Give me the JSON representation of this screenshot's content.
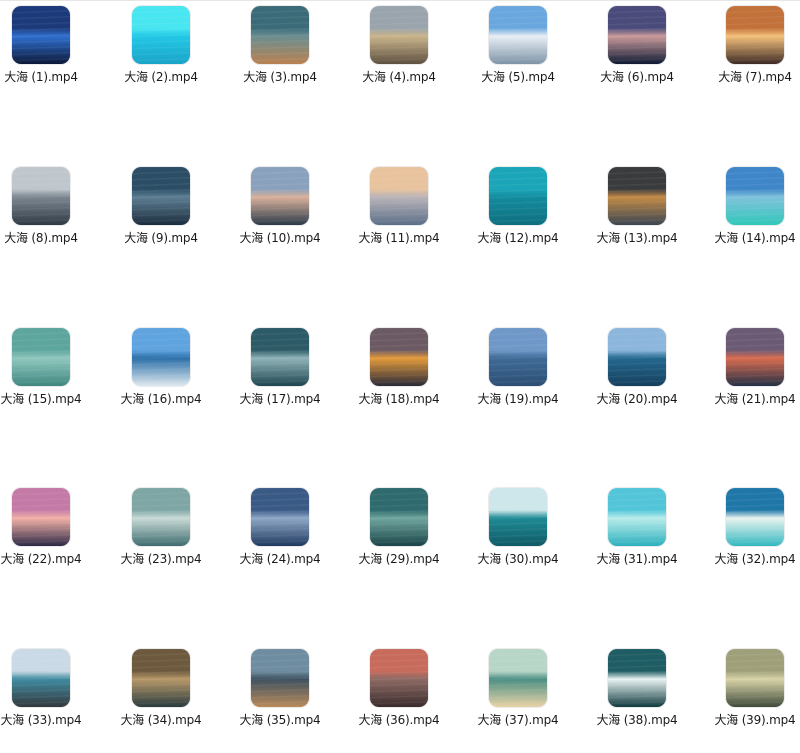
{
  "files": [
    {
      "name": "大海 (1).mp4",
      "colors": [
        "#1c3a7a",
        "#2f6fd0",
        "#0c1838"
      ],
      "icon": "video-thumbnail-icon"
    },
    {
      "name": "大海 (2).mp4",
      "colors": [
        "#48e6f0",
        "#22c8e6",
        "#1aa3c8"
      ],
      "icon": "video-thumbnail-icon"
    },
    {
      "name": "大海 (3).mp4",
      "colors": [
        "#3b6b78",
        "#6a8e92",
        "#b98150"
      ],
      "icon": "video-thumbnail-icon"
    },
    {
      "name": "大海 (4).mp4",
      "colors": [
        "#9aa4ad",
        "#c9b48a",
        "#5e5040"
      ],
      "icon": "video-thumbnail-icon"
    },
    {
      "name": "大海 (5).mp4",
      "colors": [
        "#6aa7de",
        "#e8eef5",
        "#7d93a6"
      ],
      "icon": "video-thumbnail-icon"
    },
    {
      "name": "大海 (6).mp4",
      "colors": [
        "#4a4b7a",
        "#c99a9a",
        "#0e1a33"
      ],
      "icon": "video-thumbnail-icon"
    },
    {
      "name": "大海 (7).mp4",
      "colors": [
        "#c2713a",
        "#f4c07a",
        "#3d2a25"
      ],
      "icon": "video-thumbnail-icon"
    },
    {
      "name": "大海 (8).mp4",
      "colors": [
        "#bfc6cc",
        "#7b8690",
        "#2f3a44"
      ],
      "icon": "video-thumbnail-icon"
    },
    {
      "name": "大海 (9).mp4",
      "colors": [
        "#2b4e66",
        "#5c7d92",
        "#1b2d3d"
      ],
      "icon": "video-thumbnail-icon"
    },
    {
      "name": "大海 (10).mp4",
      "colors": [
        "#8aa1bd",
        "#d8b09a",
        "#2b3a4a"
      ],
      "icon": "video-thumbnail-icon"
    },
    {
      "name": "大海 (11).mp4",
      "colors": [
        "#e8c39e",
        "#b9b3b8",
        "#5b6f88"
      ],
      "icon": "video-thumbnail-icon"
    },
    {
      "name": "大海 (12).mp4",
      "colors": [
        "#1aa6b8",
        "#138c9e",
        "#0f6f80"
      ],
      "icon": "video-thumbnail-icon"
    },
    {
      "name": "大海 (13).mp4",
      "colors": [
        "#3a3b3d",
        "#c28a45",
        "#3b4652"
      ],
      "icon": "video-thumbnail-icon"
    },
    {
      "name": "大海 (14).mp4",
      "colors": [
        "#3f86c9",
        "#7fc2dc",
        "#30c7b8"
      ],
      "icon": "video-thumbnail-icon"
    },
    {
      "name": "大海 (15).mp4",
      "colors": [
        "#5da69e",
        "#8fc7bd",
        "#3f8780"
      ],
      "icon": "video-thumbnail-icon"
    },
    {
      "name": "大海 (16).mp4",
      "colors": [
        "#5fa3df",
        "#2c6fa8",
        "#dfe9ef"
      ],
      "icon": "video-thumbnail-icon"
    },
    {
      "name": "大海 (17).mp4",
      "colors": [
        "#2c5a66",
        "#8fb3b8",
        "#1e4650"
      ],
      "icon": "video-thumbnail-icon"
    },
    {
      "name": "大海 (18).mp4",
      "colors": [
        "#6b5a63",
        "#e39a3a",
        "#2a2a38"
      ],
      "icon": "video-thumbnail-icon"
    },
    {
      "name": "大海 (19).mp4",
      "colors": [
        "#6f98c8",
        "#3e6a96",
        "#2d4f75"
      ],
      "icon": "video-thumbnail-icon"
    },
    {
      "name": "大海 (20).mp4",
      "colors": [
        "#8db6dc",
        "#23688f",
        "#16405e"
      ],
      "icon": "video-thumbnail-icon"
    },
    {
      "name": "大海 (21).mp4",
      "colors": [
        "#6b5a74",
        "#d96b4f",
        "#243045"
      ],
      "icon": "video-thumbnail-icon"
    },
    {
      "name": "大海 (22).mp4",
      "colors": [
        "#c47aa6",
        "#f2b0a6",
        "#2e2a46"
      ],
      "icon": "video-thumbnail-icon"
    },
    {
      "name": "大海 (23).mp4",
      "colors": [
        "#7ea6a4",
        "#c9dad6",
        "#3e6c6e"
      ],
      "icon": "video-thumbnail-icon"
    },
    {
      "name": "大海 (24).mp4",
      "colors": [
        "#3a5a86",
        "#8ea7c6",
        "#1f3a60"
      ],
      "icon": "video-thumbnail-icon"
    },
    {
      "name": "大海 (29).mp4",
      "colors": [
        "#2e6a6e",
        "#6fa59e",
        "#1a4448"
      ],
      "icon": "video-thumbnail-icon"
    },
    {
      "name": "大海 (30).mp4",
      "colors": [
        "#cde7ea",
        "#1e8a94",
        "#0f5a66"
      ],
      "icon": "video-thumbnail-icon"
    },
    {
      "name": "大海 (31).mp4",
      "colors": [
        "#52c6d8",
        "#b8ecea",
        "#2cb0be"
      ],
      "icon": "video-thumbnail-icon"
    },
    {
      "name": "大海 (32).mp4",
      "colors": [
        "#1f77a8",
        "#e9f3ef",
        "#33b8c0"
      ],
      "icon": "video-thumbnail-icon"
    },
    {
      "name": "大海 (33).mp4",
      "colors": [
        "#c9d9e6",
        "#3f8ba0",
        "#33383c"
      ],
      "icon": "video-thumbnail-icon"
    },
    {
      "name": "大海 (34).mp4",
      "colors": [
        "#6d5a3e",
        "#b79868",
        "#2a3b3f"
      ],
      "icon": "video-thumbnail-icon"
    },
    {
      "name": "大海 (35).mp4",
      "colors": [
        "#6f8da0",
        "#3e5160",
        "#b98a5a"
      ],
      "icon": "video-thumbnail-icon"
    },
    {
      "name": "大海 (36).mp4",
      "colors": [
        "#c76b5c",
        "#8d6a64",
        "#3a2c2c"
      ],
      "icon": "video-thumbnail-icon"
    },
    {
      "name": "大海 (37).mp4",
      "colors": [
        "#b7d6c8",
        "#4d8f84",
        "#e8d3a6"
      ],
      "icon": "video-thumbnail-icon"
    },
    {
      "name": "大海 (38).mp4",
      "colors": [
        "#1e5d63",
        "#e9f3f2",
        "#0f3a3e"
      ],
      "icon": "video-thumbnail-icon"
    },
    {
      "name": "大海 (39).mp4",
      "colors": [
        "#9fa07a",
        "#d8d3a6",
        "#3f4a3a"
      ],
      "icon": "video-thumbnail-icon"
    }
  ]
}
